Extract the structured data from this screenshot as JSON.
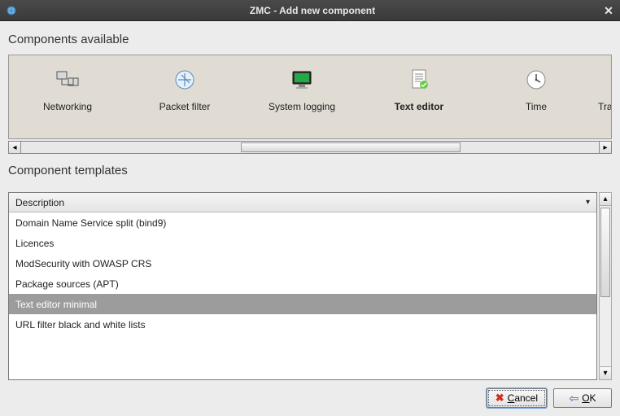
{
  "window": {
    "title": "ZMC - Add new component"
  },
  "sections": {
    "components_title": "Components available",
    "templates_title": "Component templates"
  },
  "components": [
    {
      "id": "networking",
      "label": "Networking",
      "icon": "network-icon",
      "selected": false
    },
    {
      "id": "packet-filter",
      "label": "Packet filter",
      "icon": "filter-icon",
      "selected": false
    },
    {
      "id": "system-logging",
      "label": "System logging",
      "icon": "monitor-icon",
      "selected": false
    },
    {
      "id": "text-editor",
      "label": "Text editor",
      "icon": "document-icon",
      "selected": true
    },
    {
      "id": "time",
      "label": "Time",
      "icon": "clock-icon",
      "selected": false
    },
    {
      "id": "transfer",
      "label": "Transfe",
      "icon": "gear-icon",
      "selected": false,
      "partial": true
    }
  ],
  "templates": {
    "header": "Description",
    "items": [
      {
        "label": "Domain Name Service split (bind9)",
        "selected": false
      },
      {
        "label": "Licences",
        "selected": false
      },
      {
        "label": "ModSecurity with OWASP CRS",
        "selected": false
      },
      {
        "label": "Package sources (APT)",
        "selected": false
      },
      {
        "label": "Text editor minimal",
        "selected": true
      },
      {
        "label": "URL filter black and white lists",
        "selected": false
      }
    ]
  },
  "buttons": {
    "cancel_prefix": "",
    "cancel_mnemonic": "C",
    "cancel_suffix": "ancel",
    "ok_prefix": "",
    "ok_mnemonic": "O",
    "ok_suffix": "K"
  }
}
